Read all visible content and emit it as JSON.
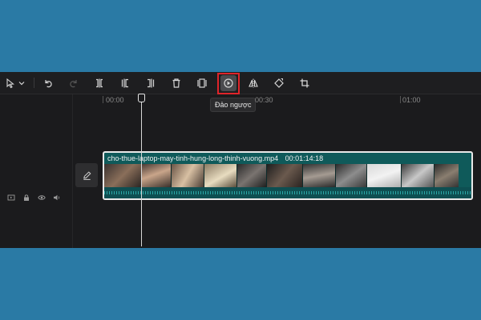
{
  "toolbar": {
    "items": [
      {
        "name": "select-cursor-icon",
        "state": "normal"
      },
      {
        "name": "chevron-down-icon",
        "state": "normal"
      },
      {
        "name": "undo-icon",
        "state": "normal"
      },
      {
        "name": "redo-icon",
        "state": "disabled"
      },
      {
        "name": "split-icon",
        "state": "normal"
      },
      {
        "name": "split-left-icon",
        "state": "normal"
      },
      {
        "name": "split-right-icon",
        "state": "normal"
      },
      {
        "name": "delete-icon",
        "state": "normal"
      },
      {
        "name": "freeze-frame-icon",
        "state": "normal"
      },
      {
        "name": "reverse-icon",
        "state": "active"
      },
      {
        "name": "mirror-icon",
        "state": "normal"
      },
      {
        "name": "rotate-icon",
        "state": "normal"
      },
      {
        "name": "crop-icon",
        "state": "normal"
      }
    ],
    "tooltip": "Đảo ngược"
  },
  "ruler": {
    "labels": [
      "00:00",
      "00:30",
      "01:00"
    ]
  },
  "clip": {
    "filename": "cho-thue-laptop-may-tinh-hung-long-thinh-vuong.mp4",
    "duration": "00:01:14:18"
  },
  "colors": {
    "accent_highlight": "#e0242a",
    "clip_bg": "#0f5a5a",
    "background": "#2a7aa5"
  }
}
